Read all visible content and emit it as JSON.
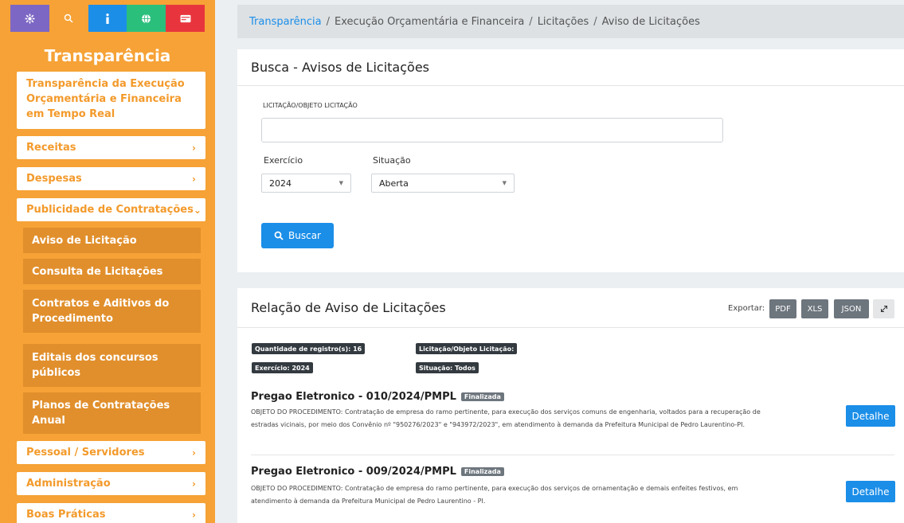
{
  "sidebar": {
    "title": "Transparência",
    "top_icons": [
      "gear-icon",
      "search-icon",
      "info-icon",
      "globe-icon",
      "id-card-icon"
    ],
    "main_item": "Transparência da Execução Orçamentária e Financeira em Tempo Real",
    "items": [
      {
        "label": "Receitas"
      },
      {
        "label": "Despesas"
      },
      {
        "label": "Publicidade de Contratações"
      },
      {
        "label": "Pessoal / Servidores"
      },
      {
        "label": "Administração"
      },
      {
        "label": "Boas Práticas"
      }
    ],
    "sub_items": [
      {
        "label": "Aviso de Licitação"
      },
      {
        "label": "Consulta de Licitações"
      },
      {
        "label": "Contratos e Aditivos do Procedimento"
      },
      {
        "label": "Editais dos concursos públicos"
      },
      {
        "label": "Planos de Contratações Anual"
      }
    ]
  },
  "breadcrumb": {
    "root": "Transparência",
    "parts": [
      "Execução Orçamentária e Financeira",
      "Licitações",
      "Aviso de Licitações"
    ]
  },
  "search": {
    "title": "Busca - Avisos de Licitações",
    "field_label": "LICITAÇÃO/OBJETO LICITAÇÃO",
    "field_value": "",
    "exercicio_label": "Exercício",
    "exercicio_value": "2024",
    "situacao_label": "Situação",
    "situacao_value": "Aberta",
    "button": "Buscar"
  },
  "results": {
    "title": "Relação de Aviso de Licitações",
    "export_label": "Exportar:",
    "export_buttons": [
      "PDF",
      "XLS",
      "JSON"
    ],
    "tags": {
      "quantidade": "Quantidade de registro(s): 16",
      "licitacao": "Licitação/Objeto Licitação:",
      "exercicio": "Exercício: 2024",
      "situacao": "Situação: Todos"
    },
    "items": [
      {
        "title": "Pregao Eletronico - 010/2024/PMPL",
        "status": "Finalizada",
        "desc1": "OBJETO DO PROCEDIMENTO: Contratação de empresa do ramo pertinente, para execução dos serviços comuns de engenharia, voltados para a recuperação de",
        "desc2": "estradas vicinais, por meio dos Convênio nº \"950276/2023\" e \"943972/2023\", em atendimento à demanda da Prefeitura Municipal de Pedro Laurentino-PI.",
        "button": "Detalhe"
      },
      {
        "title": "Pregao Eletronico - 009/2024/PMPL",
        "status": "Finalizada",
        "desc1": "OBJETO DO PROCEDIMENTO: Contratação de empresa do ramo pertinente, para execução dos serviços de ornamentação e demais enfeites festivos, em",
        "desc2": "atendimento à demanda da Prefeitura Municipal de Pedro Laurentino - PI.",
        "button": "Detalhe"
      }
    ]
  },
  "colors": {
    "sidebar": "#f6a236",
    "primary": "#1b8ee8",
    "submenu": "#e18f2c"
  }
}
